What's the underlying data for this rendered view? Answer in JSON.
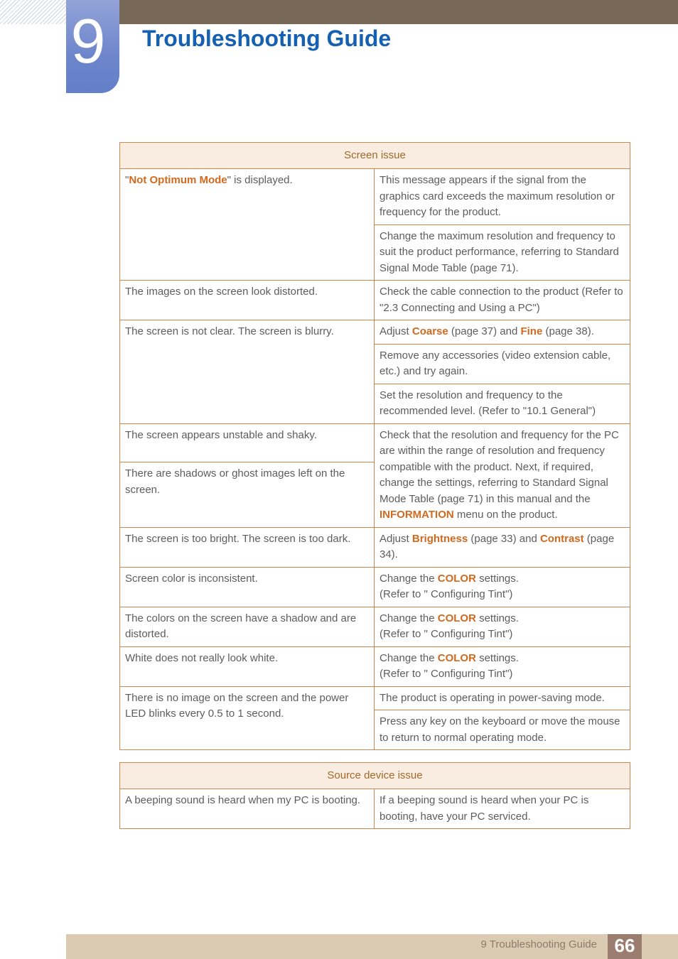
{
  "header": {
    "chapter_number": "9",
    "title": "Troubleshooting Guide"
  },
  "screen_issue_table": {
    "heading": "Screen issue",
    "rows": [
      {
        "problem": [
          {
            "t": "\""
          },
          {
            "t": "Not Optimum Mode",
            "hl": true
          },
          {
            "t": "\" is displayed."
          }
        ],
        "solutions": [
          [
            {
              "t": "This message appears if the signal from the graphics card exceeds the maximum resolution or frequency for the product."
            }
          ],
          [
            {
              "t": "Change the maximum resolution and frequency to suit the product performance, referring to Standard Signal Mode Table (page 71)."
            }
          ]
        ]
      },
      {
        "problem": [
          {
            "t": "The images on the screen look distorted."
          }
        ],
        "solutions": [
          [
            {
              "t": "Check the cable connection to the product (Refer to \"2.3 Connecting and Using a PC\")"
            }
          ]
        ]
      },
      {
        "problem": [
          {
            "t": "The screen is not clear. The screen is blurry."
          }
        ],
        "solutions": [
          [
            {
              "t": "Adjust "
            },
            {
              "t": "Coarse",
              "hl": true
            },
            {
              "t": " (page 37) and "
            },
            {
              "t": "Fine",
              "hl": true
            },
            {
              "t": " (page 38)."
            }
          ],
          [
            {
              "t": "Remove any accessories (video extension cable, etc.) and try again."
            }
          ],
          [
            {
              "t": "Set the resolution and frequency to the recommended level. (Refer to \"10.1 General\")"
            }
          ]
        ]
      },
      {
        "problems_multi": [
          [
            {
              "t": "The screen appears unstable and shaky."
            }
          ],
          [
            {
              "t": "There are shadows or ghost images left on the screen."
            }
          ]
        ],
        "solutions": [
          [
            {
              "t": "Check that the resolution and frequency for the PC are within the range of resolution and frequency compatible with the product. Next, if required, change the settings, referring to Standard Signal Mode Table (page 71) in this manual and the "
            },
            {
              "t": "INFORMATION",
              "hl": true
            },
            {
              "t": " menu on the product."
            }
          ]
        ]
      },
      {
        "problem": [
          {
            "t": "The screen is too bright. The screen is too dark."
          }
        ],
        "solutions": [
          [
            {
              "t": "Adjust "
            },
            {
              "t": "Brightness",
              "hl": true
            },
            {
              "t": " (page 33) and "
            },
            {
              "t": "Contrast",
              "hl": true
            },
            {
              "t": " (page 34)."
            }
          ]
        ]
      },
      {
        "problem": [
          {
            "t": "Screen color is inconsistent."
          }
        ],
        "solutions": [
          [
            {
              "t": "Change the "
            },
            {
              "t": "COLOR",
              "hl": true
            },
            {
              "t": " settings."
            },
            {
              "br": true
            },
            {
              "t": "(Refer to \" Configuring Tint\")"
            }
          ]
        ]
      },
      {
        "problem": [
          {
            "t": "The colors on the screen have a shadow and are distorted."
          }
        ],
        "solutions": [
          [
            {
              "t": "Change the "
            },
            {
              "t": "COLOR",
              "hl": true
            },
            {
              "t": " settings."
            },
            {
              "br": true
            },
            {
              "t": "(Refer to \" Configuring Tint\")"
            }
          ]
        ]
      },
      {
        "problem": [
          {
            "t": "White does not really look white."
          }
        ],
        "solutions": [
          [
            {
              "t": "Change the "
            },
            {
              "t": "COLOR",
              "hl": true
            },
            {
              "t": " settings."
            },
            {
              "br": true
            },
            {
              "t": "(Refer to \" Configuring Tint\")"
            }
          ]
        ]
      },
      {
        "problem": [
          {
            "t": "There is no image on the screen and the power LED blinks every 0.5 to 1 second."
          }
        ],
        "solutions": [
          [
            {
              "t": "The product is operating in power-saving mode."
            }
          ],
          [
            {
              "t": "Press any key on the keyboard or move the mouse to return to normal operating mode."
            }
          ]
        ]
      }
    ]
  },
  "source_issue_table": {
    "heading": "Source device issue",
    "rows": [
      {
        "problem": [
          {
            "t": "A beeping sound is heard when my PC is booting."
          }
        ],
        "solutions": [
          [
            {
              "t": "If a beeping sound is heard when your PC is booting, have your PC serviced."
            }
          ]
        ]
      }
    ]
  },
  "footer": {
    "label": "9 Troubleshooting Guide",
    "page_number": "66"
  },
  "colors": {
    "title_blue": "#1560b0",
    "highlight_orange": "#d2691e",
    "table_border": "#c9884f",
    "header_bg": "#f9ece0",
    "topbar": "#776858",
    "footer_bg": "#dccbb3",
    "page_box": "#9a7d6e"
  }
}
